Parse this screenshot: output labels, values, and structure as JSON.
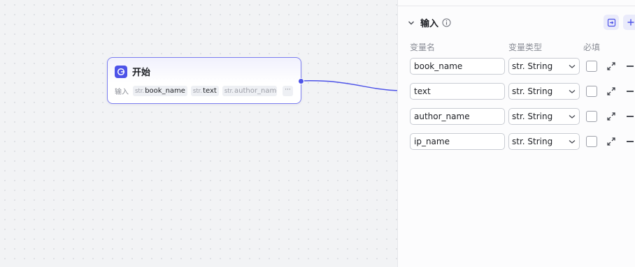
{
  "canvas": {
    "node": {
      "title": "开始",
      "input_label": "输入",
      "params": [
        {
          "type": "str.",
          "name": "book_name"
        },
        {
          "type": "str.",
          "name": "text"
        },
        {
          "type": "str.",
          "name": "author_name"
        }
      ],
      "more": "···"
    },
    "colors": {
      "accent": "#4d53e8",
      "node_border": "#7c7ff0"
    }
  },
  "panel": {
    "section_title": "输入",
    "columns": {
      "name": "变量名",
      "type": "变量类型",
      "required": "必填"
    },
    "rows": [
      {
        "name": "book_name",
        "type": "str. String"
      },
      {
        "name": "text",
        "type": "str. String"
      },
      {
        "name": "author_name",
        "type": "str. String"
      },
      {
        "name": "ip_name",
        "type": "str. String"
      }
    ],
    "icons": [
      "chevron-down-icon",
      "info-icon",
      "import-icon",
      "plus-icon",
      "expand-icon",
      "minus-icon"
    ]
  }
}
